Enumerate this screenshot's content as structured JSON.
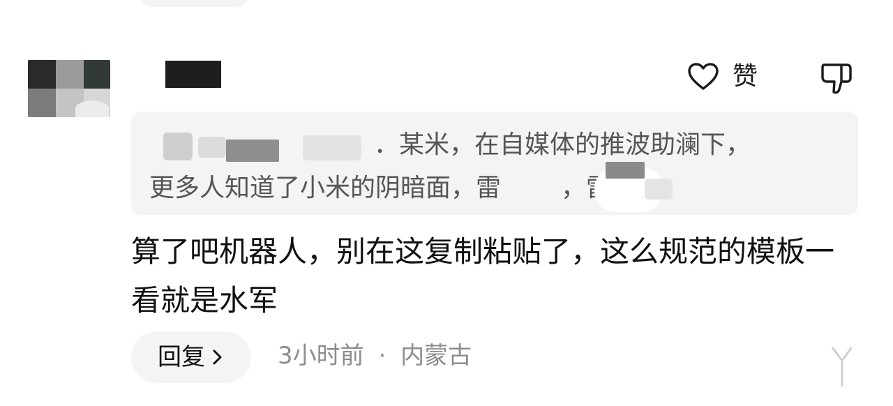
{
  "comment": {
    "like_label": "赞",
    "quoted": {
      "line1": "．某米，在自媒体的推波助澜下，",
      "line2": "更多人知道了小米的阴暗面，雷",
      "line2_tail": "，雷买..."
    },
    "body": "算了吧机器人，别在这复制粘贴了，这么规范的模板一看就是水军",
    "reply_label": "回复",
    "time": "3小时前",
    "separator": "·",
    "location": "内蒙古"
  },
  "icons": {
    "like": "heart-outline-icon",
    "dislike": "thumbs-down-icon",
    "reply_chevron": "chevron-right-icon",
    "expand": "collapse-arrow-icon"
  },
  "colors": {
    "text_primary": "#111111",
    "text_secondary": "#8d8d8d",
    "quote_text": "#555555",
    "quote_background": "#f4f4f4",
    "pill_background": "#f4f4f4",
    "mask_dark": "#1e1e1e"
  }
}
